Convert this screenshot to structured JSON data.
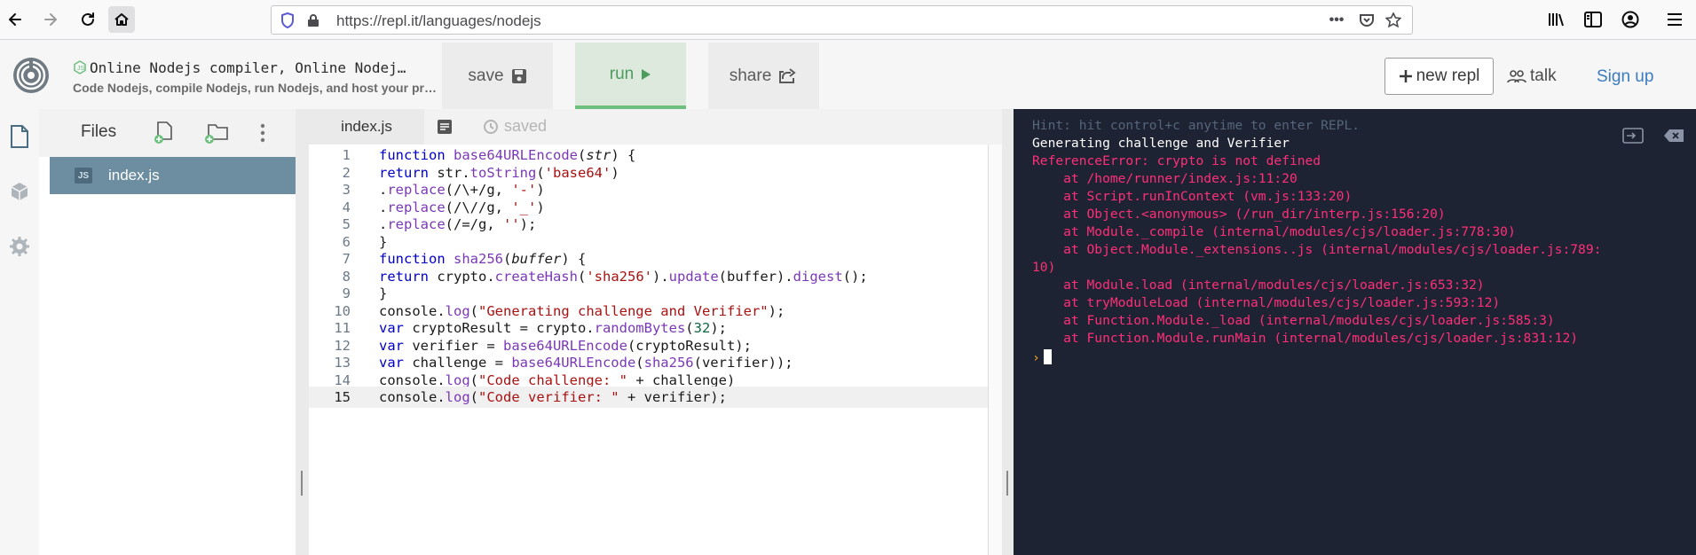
{
  "browser": {
    "url": "https://repl.it/languages/nodejs",
    "page_actions": "•••"
  },
  "header": {
    "title": "Online Nodejs compiler, Online Nodej…",
    "subtitle": "Code Nodejs, compile Nodejs, run Nodejs, and host your pr…",
    "save_label": "save",
    "run_label": "run",
    "share_label": "share",
    "new_repl_label": "new repl",
    "talk_label": "talk",
    "signup_label": "Sign up"
  },
  "files": {
    "title": "Files",
    "items": [
      {
        "name": "index.js",
        "badge": "JS"
      }
    ]
  },
  "editor": {
    "tab_label": "index.js",
    "status": "saved",
    "active_line": 15,
    "lines": [
      {
        "n": "1"
      },
      {
        "n": "2"
      },
      {
        "n": "3"
      },
      {
        "n": "4"
      },
      {
        "n": "5"
      },
      {
        "n": "6"
      },
      {
        "n": "7"
      },
      {
        "n": "8"
      },
      {
        "n": "9"
      },
      {
        "n": "10"
      },
      {
        "n": "11"
      },
      {
        "n": "12"
      },
      {
        "n": "13"
      },
      {
        "n": "14"
      },
      {
        "n": "15"
      }
    ],
    "code": [
      [
        "function ",
        "base64URLEncode",
        "(",
        "str",
        ") {"
      ],
      [
        "return ",
        "str.",
        "toString",
        "(",
        "'base64'",
        ")"
      ],
      [
        ".",
        "replace",
        "(/\\+/g, ",
        "'-'",
        ")"
      ],
      [
        ".",
        "replace",
        "(/\\//g, ",
        "'_'",
        ")"
      ],
      [
        ".",
        "replace",
        "(/=/g, ",
        "''",
        ");"
      ],
      [
        "}"
      ],
      [
        "function ",
        "sha256",
        "(",
        "buffer",
        ") {"
      ],
      [
        "return ",
        "crypto.",
        "createHash",
        "(",
        "'sha256'",
        ").",
        "update",
        "(buffer).",
        "digest",
        "();"
      ],
      [
        "}"
      ],
      [
        "console.",
        "log",
        "(",
        "\"Generating challenge and Verifier\"",
        ");"
      ],
      [
        "var ",
        "cryptoResult = crypto.",
        "randomBytes",
        "(",
        "32",
        ");"
      ],
      [
        "var ",
        "verifier = ",
        "base64URLEncode",
        "(cryptoResult);"
      ],
      [
        "var ",
        "challenge = ",
        "base64URLEncode",
        "(",
        "sha256",
        "(verifier));"
      ],
      [
        "console.",
        "log",
        "(",
        "\"Code challenge: \"",
        " + challenge)"
      ],
      [
        "console.",
        "log",
        "(",
        "\"Code verifier: \"",
        " + verifier);"
      ]
    ]
  },
  "console": {
    "hint": "Hint: hit control+c anytime to enter REPL.",
    "output": "Generating challenge and Verifier",
    "error_lines": [
      "ReferenceError: crypto is not defined",
      "    at /home/runner/index.js:11:20",
      "    at Script.runInContext (vm.js:133:20)",
      "    at Object.<anonymous> (/run_dir/interp.js:156:20)",
      "    at Module._compile (internal/modules/cjs/loader.js:778:30)",
      "    at Object.Module._extensions..js (internal/modules/cjs/loader.js:789:",
      "10)",
      "    at Module.load (internal/modules/cjs/loader.js:653:32)",
      "    at tryModuleLoad (internal/modules/cjs/loader.js:593:12)",
      "    at Function.Module._load (internal/modules/cjs/loader.js:585:3)",
      "    at Function.Module.runMain (internal/modules/cjs/loader.js:831:12)"
    ],
    "prompt": "›"
  },
  "colors": {
    "run_accent": "#6cbf7d",
    "console_bg": "#1d2333",
    "error": "#ff2f78",
    "file_selected": "#6d8ea0",
    "signup": "#3b7bbf"
  },
  "icons": [
    "back-arrow-icon",
    "forward-arrow-icon",
    "reload-icon",
    "home-icon",
    "shield-icon",
    "lock-icon",
    "pocket-icon",
    "star-icon",
    "library-icon",
    "sidebar-icon",
    "account-icon",
    "hamburger-menu-icon",
    "repl-logo-icon",
    "nodejs-icon",
    "floppy-disk-icon",
    "play-icon",
    "share-icon",
    "plus-icon",
    "people-icon",
    "file-icon",
    "cube-icon",
    "gear-icon",
    "add-file-icon",
    "add-folder-icon",
    "kebab-menu-icon",
    "format-icon",
    "history-icon",
    "console-input-icon",
    "clear-console-icon"
  ]
}
